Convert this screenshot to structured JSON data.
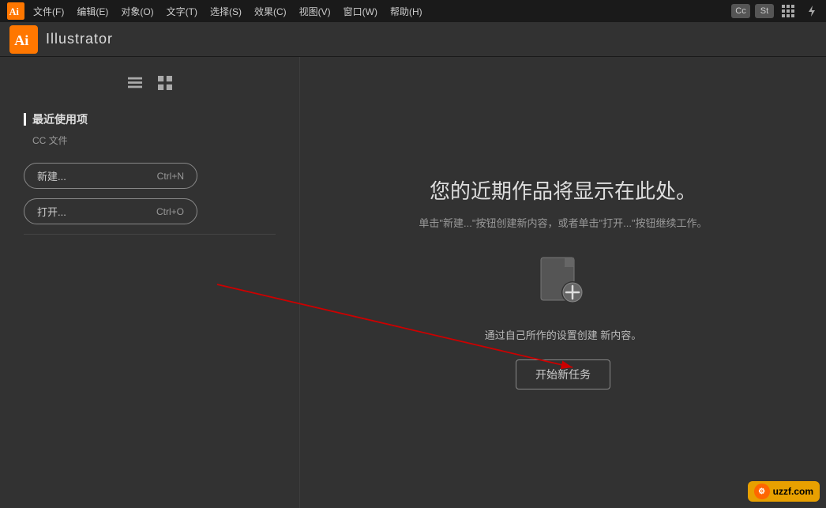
{
  "titlebar": {
    "app_logo_text": "Ai",
    "menu_items": [
      {
        "label": "文件(F)",
        "id": "file"
      },
      {
        "label": "编辑(E)",
        "id": "edit"
      },
      {
        "label": "对象(O)",
        "id": "object"
      },
      {
        "label": "文字(T)",
        "id": "text"
      },
      {
        "label": "选择(S)",
        "id": "select"
      },
      {
        "label": "效果(C)",
        "id": "effect"
      },
      {
        "label": "视图(V)",
        "id": "view"
      },
      {
        "label": "窗口(W)",
        "id": "window"
      },
      {
        "label": "帮助(H)",
        "id": "help"
      }
    ]
  },
  "appbar": {
    "logo_text": "Ai",
    "title": "Illustrator"
  },
  "left_panel": {
    "section_title": "最近使用项",
    "section_sub": "CC 文件",
    "new_button": "新建...",
    "new_shortcut": "Ctrl+N",
    "open_button": "打开...",
    "open_shortcut": "Ctrl+O"
  },
  "right_panel": {
    "welcome_title": "您的近期作品将显示在此处。",
    "welcome_subtitle": "单击\"新建...\"按钮创建新内容，或者单击\"打开...\"按钮继续工作。",
    "settings_desc": "通过自己所作的设置创建\n新内容。",
    "start_button": "开始新任务"
  },
  "watermark": {
    "text": "uzzf.com"
  }
}
